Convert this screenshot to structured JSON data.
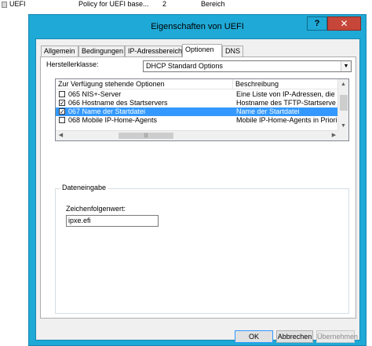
{
  "background_row": {
    "col1": "UEFI",
    "col2": "Policy for UEFI base...",
    "col3": "2",
    "col4": "Bereich"
  },
  "window": {
    "title": "Eigenschaften von UEFI",
    "help_label": "?",
    "close_label": "✕"
  },
  "tabs": [
    {
      "label": "Allgemein"
    },
    {
      "label": "Bedingungen"
    },
    {
      "label": "IP-Adressbereich"
    },
    {
      "label": "Optionen"
    },
    {
      "label": "DNS"
    }
  ],
  "vendor_class": {
    "label": "Herstellerklasse:",
    "value": "DHCP Standard Options"
  },
  "options_list": {
    "columns": [
      "Zur Verfügung stehende Optionen",
      "Beschreibung"
    ],
    "rows": [
      {
        "checked": "",
        "name": "065 NIS+-Server",
        "description": "Eine Liste von IP-Adressen, die"
      },
      {
        "checked": "✓",
        "name": "066 Hostname des Startservers",
        "description": "Hostname des TFTP-Startserve"
      },
      {
        "checked": "✓",
        "name": "067 Name der Startdatei",
        "description": "Name der Startdatei"
      },
      {
        "checked": "",
        "name": "068 Mobile IP-Home-Agents",
        "description": "Mobile IP-Home-Agents in Priori"
      }
    ]
  },
  "data_entry": {
    "group_label": "Dateneingabe",
    "string_label": "Zeichenfolgenwert:",
    "string_value": "ipxe.efi"
  },
  "buttons": {
    "ok": "OK",
    "cancel": "Abbrechen",
    "apply": "Übernehmen"
  }
}
